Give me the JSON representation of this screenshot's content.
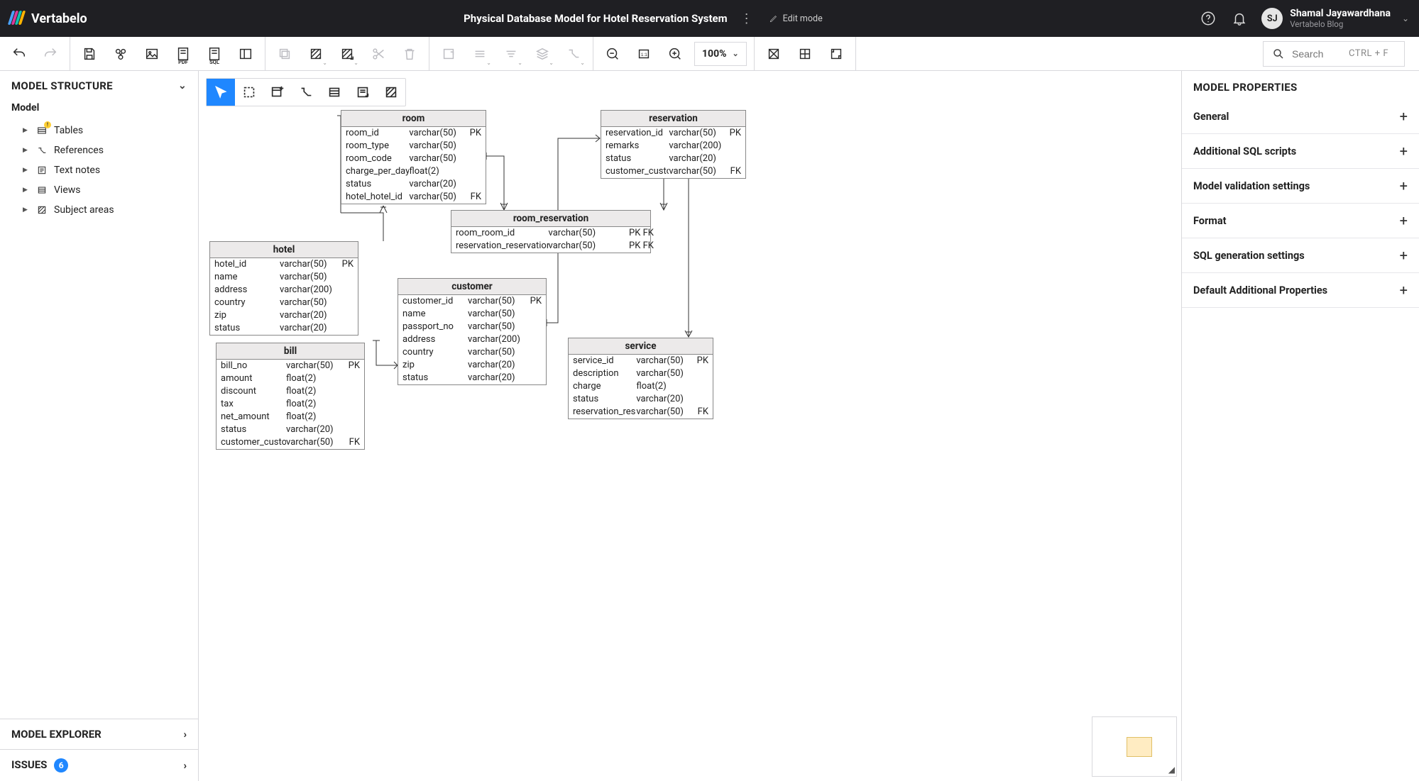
{
  "header": {
    "brand": "Vertabelo",
    "title": "Physical Database Model for Hotel Reservation System",
    "edit_mode": "Edit mode",
    "user_initials": "SJ",
    "user_name": "Shamal Jayawardhana",
    "user_tag": "Vertabelo Blog"
  },
  "toolbar": {
    "zoom": "100%",
    "search_placeholder": "Search",
    "search_hint": "CTRL + F"
  },
  "left": {
    "structure_title": "MODEL STRUCTURE",
    "model_label": "Model",
    "tree": {
      "tables": "Tables",
      "references": "References",
      "textnotes": "Text notes",
      "views": "Views",
      "subjectareas": "Subject areas"
    },
    "explorer_title": "MODEL EXPLORER",
    "issues_title": "ISSUES",
    "issues_count": "6"
  },
  "right": {
    "title": "MODEL PROPERTIES",
    "sections": {
      "general": "General",
      "sql_scripts": "Additional SQL scripts",
      "validation": "Model validation settings",
      "format": "Format",
      "sqlgen": "SQL generation settings",
      "default_props": "Default Additional Properties"
    }
  },
  "entities": {
    "room": {
      "name": "room",
      "cols": [
        {
          "n": "room_id",
          "t": "varchar(50)",
          "k": "PK"
        },
        {
          "n": "room_type",
          "t": "varchar(50)",
          "k": ""
        },
        {
          "n": "room_code",
          "t": "varchar(50)",
          "k": ""
        },
        {
          "n": "charge_per_day",
          "t": "float(2)",
          "k": ""
        },
        {
          "n": "status",
          "t": "varchar(20)",
          "k": ""
        },
        {
          "n": "hotel_hotel_id",
          "t": "varchar(50)",
          "k": "FK"
        }
      ]
    },
    "reservation": {
      "name": "reservation",
      "cols": [
        {
          "n": "reservation_id",
          "t": "varchar(50)",
          "k": "PK"
        },
        {
          "n": "remarks",
          "t": "varchar(200)",
          "k": ""
        },
        {
          "n": "status",
          "t": "varchar(20)",
          "k": ""
        },
        {
          "n": "customer_custom",
          "t": "varchar(50)",
          "k": "FK"
        }
      ]
    },
    "room_reservation": {
      "name": "room_reservation",
      "cols": [
        {
          "n": "room_room_id",
          "t": "varchar(50)",
          "k": "PK FK"
        },
        {
          "n": "reservation_reservation_id",
          "t": "varchar(50)",
          "k": "PK FK"
        }
      ]
    },
    "hotel": {
      "name": "hotel",
      "cols": [
        {
          "n": "hotel_id",
          "t": "varchar(50)",
          "k": "PK"
        },
        {
          "n": "name",
          "t": "varchar(50)",
          "k": ""
        },
        {
          "n": "address",
          "t": "varchar(200)",
          "k": ""
        },
        {
          "n": "country",
          "t": "varchar(50)",
          "k": ""
        },
        {
          "n": "zip",
          "t": "varchar(20)",
          "k": ""
        },
        {
          "n": "status",
          "t": "varchar(20)",
          "k": ""
        }
      ]
    },
    "customer": {
      "name": "customer",
      "cols": [
        {
          "n": "customer_id",
          "t": "varchar(50)",
          "k": "PK"
        },
        {
          "n": "name",
          "t": "varchar(50)",
          "k": ""
        },
        {
          "n": "passport_no",
          "t": "varchar(50)",
          "k": ""
        },
        {
          "n": "address",
          "t": "varchar(200)",
          "k": ""
        },
        {
          "n": "country",
          "t": "varchar(50)",
          "k": ""
        },
        {
          "n": "zip",
          "t": "varchar(20)",
          "k": ""
        },
        {
          "n": "status",
          "t": "varchar(20)",
          "k": ""
        }
      ]
    },
    "bill": {
      "name": "bill",
      "cols": [
        {
          "n": "bill_no",
          "t": "varchar(50)",
          "k": "PK"
        },
        {
          "n": "amount",
          "t": "float(2)",
          "k": ""
        },
        {
          "n": "discount",
          "t": "float(2)",
          "k": ""
        },
        {
          "n": "tax",
          "t": "float(2)",
          "k": ""
        },
        {
          "n": "net_amount",
          "t": "float(2)",
          "k": ""
        },
        {
          "n": "status",
          "t": "varchar(20)",
          "k": ""
        },
        {
          "n": "customer_customer",
          "t": "varchar(50)",
          "k": "FK"
        }
      ]
    },
    "service": {
      "name": "service",
      "cols": [
        {
          "n": "service_id",
          "t": "varchar(50)",
          "k": "PK"
        },
        {
          "n": "description",
          "t": "varchar(50)",
          "k": ""
        },
        {
          "n": "charge",
          "t": "float(2)",
          "k": ""
        },
        {
          "n": "status",
          "t": "varchar(20)",
          "k": ""
        },
        {
          "n": "reservation_reserva",
          "t": "varchar(50)",
          "k": "FK"
        }
      ]
    }
  }
}
